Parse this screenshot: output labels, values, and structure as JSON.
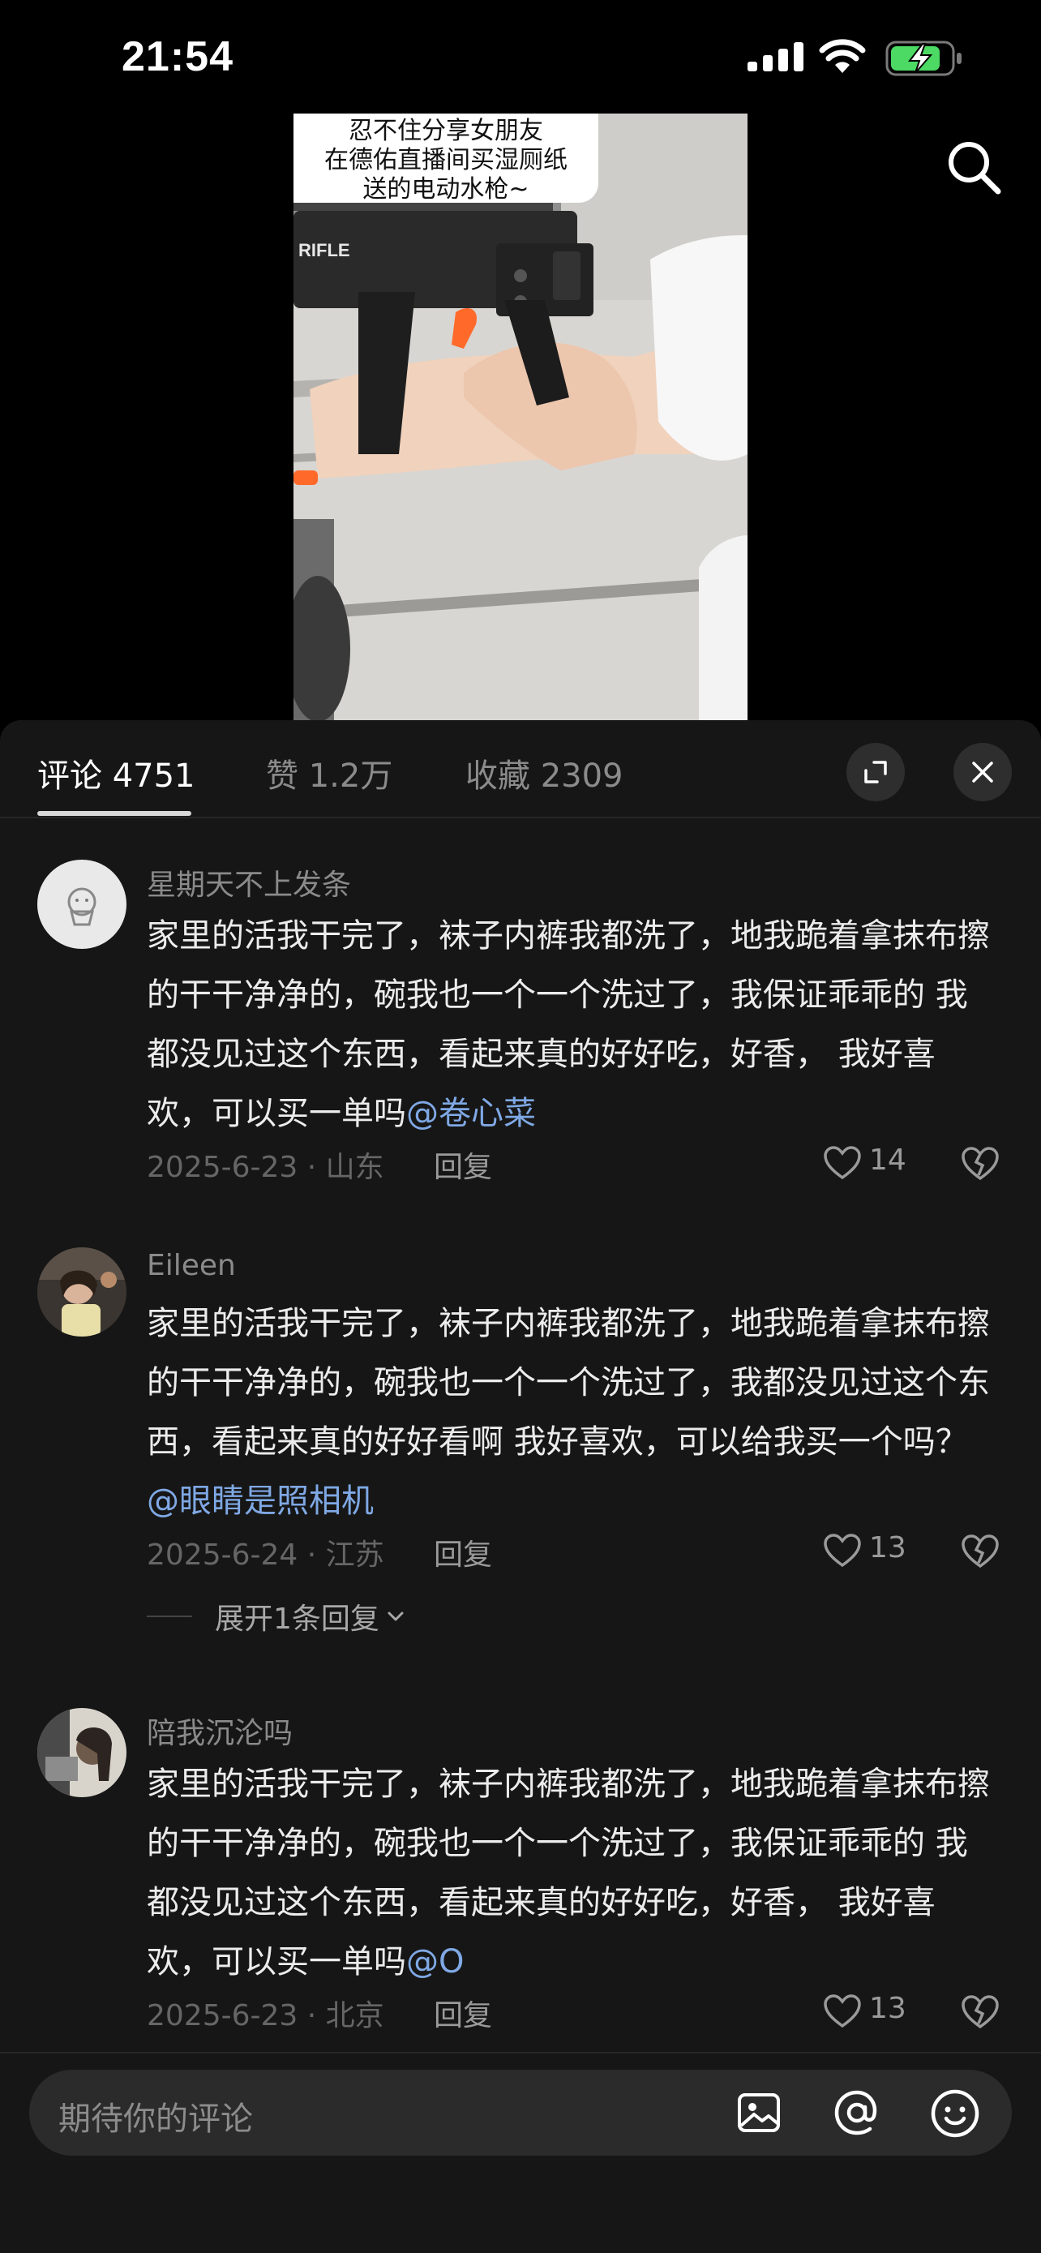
{
  "status_bar": {
    "time": "21:54"
  },
  "video": {
    "caption": "忍不住分享女朋友\n在德佑直播间买湿厕纸\n送的电动水枪~",
    "gun_label": "RIFLE"
  },
  "tabs": [
    {
      "label": "评论 4751",
      "active": true
    },
    {
      "label": "赞 1.2万",
      "active": false
    },
    {
      "label": "收藏 2309",
      "active": false
    }
  ],
  "comments": [
    {
      "username": "星期天不上发条",
      "text": "家里的活我干完了，袜子内裤我都洗了，地我跪着拿抹布擦的干干净净的，碗我也一个一个洗过了，我保证乖乖的 我都没见过这个东西，看起来真的好好吃，好香，  我好喜欢，可以买一单吗",
      "mention": "@卷心菜",
      "date_location": "2025-6-23 · 山东",
      "reply_label": "回复",
      "likes": "14"
    },
    {
      "username": "Eileen",
      "text": "家里的活我干完了，袜子内裤我都洗了，地我跪着拿抹布擦的干干净净的，碗我也一个一个洗过了，我都没见过这个东西，看起来真的好好看啊  我好喜欢，可以给我买一个吗？",
      "mention": "@眼睛是照相机",
      "date_location": "2025-6-24 · 江苏",
      "reply_label": "回复",
      "likes": "13",
      "expand_replies": "展开1条回复"
    },
    {
      "username": "陪我沉沦吗",
      "text": "家里的活我干完了，袜子内裤我都洗了，地我跪着拿抹布擦的干干净净的，碗我也一个一个洗过了，我保证乖乖的 我都没见过这个东西，看起来真的好好吃，好香，  我好喜欢，可以买一单吗",
      "mention": "@O",
      "date_location": "2025-6-23 · 北京",
      "reply_label": "回复",
      "likes": "13"
    }
  ],
  "input": {
    "placeholder": "期待你的评论"
  },
  "colors": {
    "panel_bg": "#161616",
    "mention": "#7fa8e4",
    "battery_green": "#4cd964",
    "trigger_orange": "#ff6a2b"
  }
}
